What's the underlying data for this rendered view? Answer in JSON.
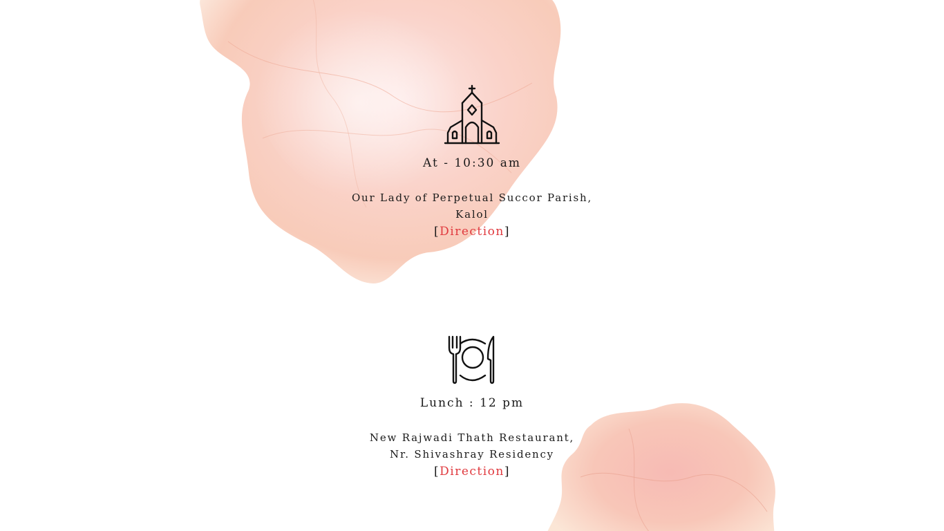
{
  "ceremony": {
    "icon": "church-icon",
    "time": "At - 10:30 am",
    "venue_line1": "Our Lady of Perpetual Succor Parish,",
    "venue_line2": "Kalol",
    "bracket_open": "[",
    "direction_label": "Direction",
    "bracket_close": "]"
  },
  "lunch": {
    "icon": "plate-cutlery-icon",
    "time": "Lunch : 12 pm",
    "venue_line1": "New Rajwadi Thath Restaurant,",
    "venue_line2": "Nr. Shivashray Residency",
    "bracket_open": "[",
    "direction_label": "Direction",
    "bracket_close": "]"
  },
  "colors": {
    "link": "#e0393e",
    "text": "#1a1a1a",
    "watercolor": "#f6b9aa"
  }
}
